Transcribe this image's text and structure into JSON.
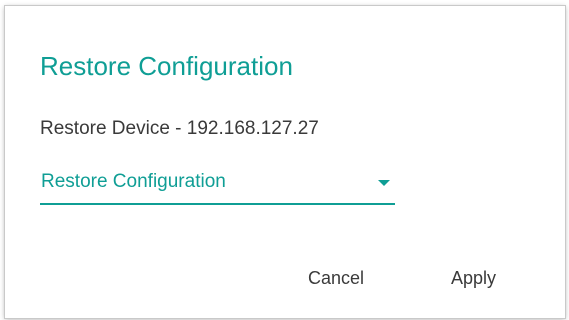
{
  "dialog": {
    "title": "Restore Configuration",
    "subtitle": "Restore Device - 192.168.127.27",
    "select": {
      "value": "Restore Configuration"
    },
    "actions": {
      "cancel_label": "Cancel",
      "apply_label": "Apply"
    }
  },
  "colors": {
    "accent": "#0f9e95",
    "text": "#3a3a3a",
    "background": "#ffffff"
  },
  "icons": {
    "dropdown": "chevron-down-icon"
  }
}
